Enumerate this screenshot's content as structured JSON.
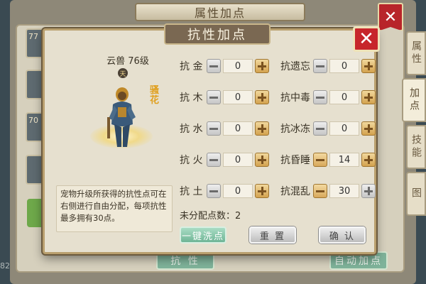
{
  "background": {
    "title": "属性加点",
    "close_label": "✕",
    "thumbs": [
      "77",
      "",
      "70",
      ""
    ],
    "side_number": "82",
    "tabs": [
      "属性",
      "加点",
      "技能",
      "图"
    ],
    "bottom_left_button": "抗 性",
    "bottom_right_button": "自动加点"
  },
  "dialog": {
    "title": "抗性加点",
    "close_label": "✕"
  },
  "pet": {
    "name": "云兽 76级",
    "badge": "天",
    "tag": "骚 花",
    "description": "宠物升级所获得的抗性点可在右侧进行自由分配，每项抗性最多拥有30点。"
  },
  "stats_left": [
    {
      "label": "抗 金",
      "value": "0"
    },
    {
      "label": "抗 木",
      "value": "0"
    },
    {
      "label": "抗 水",
      "value": "0"
    },
    {
      "label": "抗 火",
      "value": "0"
    },
    {
      "label": "抗 土",
      "value": "0"
    }
  ],
  "stats_right": [
    {
      "label": "抗遗忘",
      "value": "0"
    },
    {
      "label": "抗中毒",
      "value": "0"
    },
    {
      "label": "抗冰冻",
      "value": "0"
    },
    {
      "label": "抗昏睡",
      "value": "14"
    },
    {
      "label": "抗混乱",
      "value": "30"
    }
  ],
  "remaining_points": "未分配点数：2",
  "buttons": {
    "reset_all": "一键洗点",
    "reset": "重 置",
    "confirm": "确 认"
  },
  "colors": {
    "accent_gold": "#d3a24f",
    "close_red": "#c7262b",
    "green_button": "#6fb596"
  }
}
